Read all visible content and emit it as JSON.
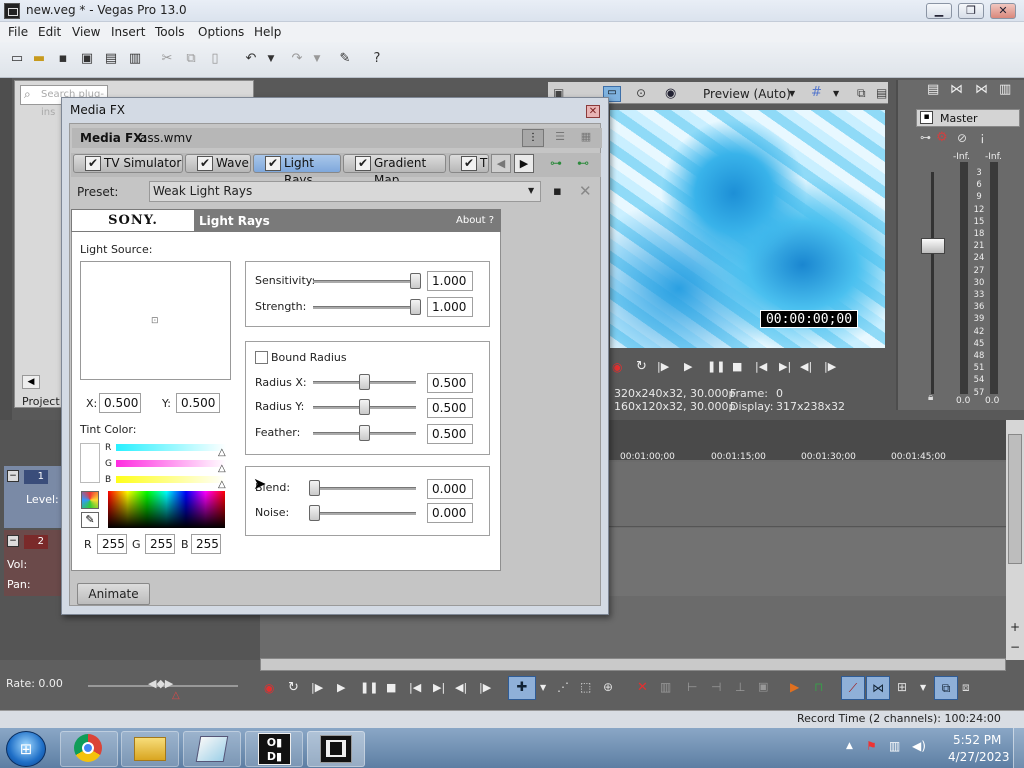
{
  "app": {
    "title": "new.veg * - Vegas Pro 13.0"
  },
  "window_buttons": {
    "minimize": "▁",
    "maximize": "❐",
    "close": "✕"
  },
  "menu": [
    "File",
    "Edit",
    "View",
    "Insert",
    "Tools",
    "Options",
    "Help"
  ],
  "left_panel": {
    "search_placeholder": "Search plug-ins",
    "property": "Property",
    "tab_project": "Project"
  },
  "preview": {
    "mode": "Preview (Auto)",
    "timecode": "00:00:00;00",
    "project_info": "320x240x32, 30.000p",
    "preview_info": "160x120x32, 30.000p",
    "frame_label": "Frame:",
    "frame_value": "0",
    "display_label": "Display:",
    "display_value": "317x238x32"
  },
  "mixer": {
    "master_label": "Master",
    "inf_left": "-Inf.",
    "inf_right": "-Inf.",
    "scale": [
      "3",
      "6",
      "9",
      "12",
      "15",
      "18",
      "21",
      "24",
      "27",
      "30",
      "33",
      "36",
      "39",
      "42",
      "45",
      "48",
      "51",
      "54",
      "57"
    ],
    "bottom_left": "0.0",
    "bottom_right": "0.0"
  },
  "dialog": {
    "title": "Media FX",
    "media_fx_label": "Media FX:",
    "media_fx_file": "ass.wmv",
    "chain": [
      {
        "label": "TV Simulator",
        "active": false
      },
      {
        "label": "Wave",
        "active": false
      },
      {
        "label": "Light Rays",
        "active": true
      },
      {
        "label": "Gradient Map",
        "active": false
      },
      {
        "label": "Ti",
        "active": false
      }
    ],
    "preset_label": "Preset:",
    "preset_value": "Weak Light Rays",
    "brand": "SONY.",
    "plugin_name": "Light Rays",
    "about": "About  ?",
    "light_source_label": "Light Source:",
    "x_label": "X:",
    "x_value": "0.500",
    "y_label": "Y:",
    "y_value": "0.500",
    "tint_label": "Tint Color:",
    "r_label": "R",
    "g_label": "G",
    "b_label": "B",
    "r_value": "255",
    "g_value": "255",
    "b_value": "255",
    "sensitivity_label": "Sensitivity:",
    "sensitivity_value": "1.000",
    "strength_label": "Strength:",
    "strength_value": "1.000",
    "bound_radius_label": "Bound Radius",
    "radius_x_label": "Radius X:",
    "radius_x_value": "0.500",
    "radius_y_label": "Radius Y:",
    "radius_y_value": "0.500",
    "feather_label": "Feather:",
    "feather_value": "0.500",
    "blend_label": "Blend:",
    "blend_value": "0.000",
    "noise_label": "Noise:",
    "noise_value": "0.000",
    "animate_button": "Animate"
  },
  "tracks": {
    "track1_num": "1",
    "level_label": "Level:",
    "track2_num": "2",
    "vol_label": "Vol:",
    "pan_label": "Pan:"
  },
  "timeline": {
    "ruler": [
      "00:01:00;00",
      "00:01:15;00",
      "00:01:30;00",
      "00:01:45;00"
    ]
  },
  "transport": {
    "rate": "Rate: 0.00",
    "record_time": "Record Time (2 channels): 100:24:00"
  },
  "taskbar": {
    "clock_time": "5:52 PM",
    "clock_date": "4/27/2023"
  },
  "colors": {
    "accent": "#7fa8dc",
    "dark_panel": "#595959",
    "record": "#d23030"
  }
}
